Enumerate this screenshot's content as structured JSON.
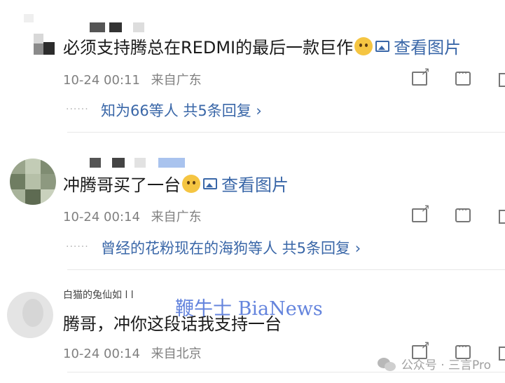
{
  "comments": [
    {
      "text": "必须支持腾总在REDMI的最后一款巨作",
      "view_pictures": "查看图片",
      "time": "10-24 00:11",
      "location": "来自广东",
      "replies": "知为66等人  共5条回复 ›"
    },
    {
      "text": "冲腾哥买了一台",
      "view_pictures": "查看图片",
      "time": "10-24 00:14",
      "location": "来自广东",
      "replies": "曾经的花粉现在的海狗等人  共5条回复 ›"
    },
    {
      "partial_name": "白猫的兔仙如 l l",
      "text": "腾哥，冲你这段话我支持一台",
      "time": "10-24 00:14",
      "location": "来自北京"
    }
  ],
  "watermark": "鞭牛士 BiaNews",
  "wx_badge": "公众号 · 三言Pro",
  "colors": {
    "link": "#3a67a8",
    "meta": "#808080",
    "watermark": "#4a6fd8"
  }
}
